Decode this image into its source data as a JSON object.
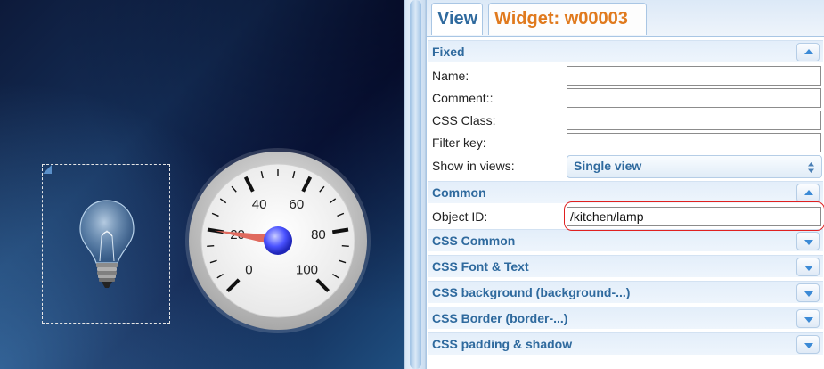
{
  "gauge": {
    "labels": [
      "0",
      "20",
      "40",
      "60",
      "80",
      "100"
    ],
    "value": 20
  },
  "colors": {
    "accent_blue": "#2f6a9e",
    "widget_tab_orange": "#e07a1e",
    "highlight_red": "#e02020",
    "needle": "#e06a5e"
  },
  "tabs": {
    "view": "View",
    "widget": "Widget: w00003"
  },
  "sections": {
    "fixed": "Fixed",
    "common": "Common",
    "css_common": "CSS Common",
    "css_font_text": "CSS Font & Text",
    "css_background": "CSS background (background-...)",
    "css_border": "CSS Border (border-...)",
    "css_padding_shadow": "CSS padding & shadow"
  },
  "fields": {
    "name": {
      "label": "Name:",
      "value": ""
    },
    "comment": {
      "label": "Comment::",
      "value": ""
    },
    "css_class": {
      "label": "CSS Class:",
      "value": ""
    },
    "filter_key": {
      "label": "Filter key:",
      "value": ""
    },
    "show_in_views": {
      "label": "Show in views:",
      "value": "Single view"
    },
    "object_id": {
      "label": "Object ID:",
      "value": "/kitchen/lamp"
    }
  },
  "icons": {
    "lamp": "light-bulb-icon",
    "collapse": "chevron-up-icon",
    "expand": "chevron-down-icon"
  }
}
